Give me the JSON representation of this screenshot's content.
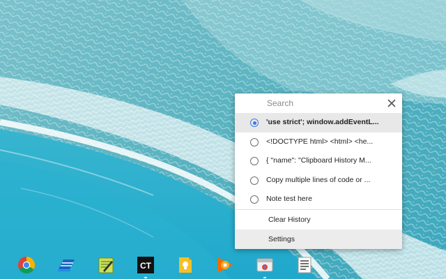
{
  "popup": {
    "search": {
      "placeholder": "Search",
      "value": ""
    },
    "items": [
      {
        "label": "'use strict'; window.addEventL...",
        "selected": true
      },
      {
        "label": "<!DOCTYPE html> <html> <he...",
        "selected": false
      },
      {
        "label": "{ \"name\": \"Clipboard History M...",
        "selected": false
      },
      {
        "label": "Copy multiple lines of code or ...",
        "selected": false
      },
      {
        "label": "Note test here",
        "selected": false
      }
    ],
    "clear_history_label": "Clear History",
    "settings_label": "Settings"
  },
  "shelf": {
    "apps": [
      {
        "icon": "chrome-icon"
      },
      {
        "icon": "app-blue-stripes-icon"
      },
      {
        "icon": "notepad-pen-icon"
      },
      {
        "icon": "ct-icon",
        "label": "CT"
      },
      {
        "icon": "keep-bulb-icon"
      },
      {
        "icon": "google-play-music-icon"
      },
      {
        "icon": "chrome-window-icon"
      },
      {
        "icon": "document-icon"
      }
    ]
  },
  "colors": {
    "accent": "#3b78e7",
    "popup_bg": "#ffffff",
    "selected_bg": "#e8e8e8"
  }
}
